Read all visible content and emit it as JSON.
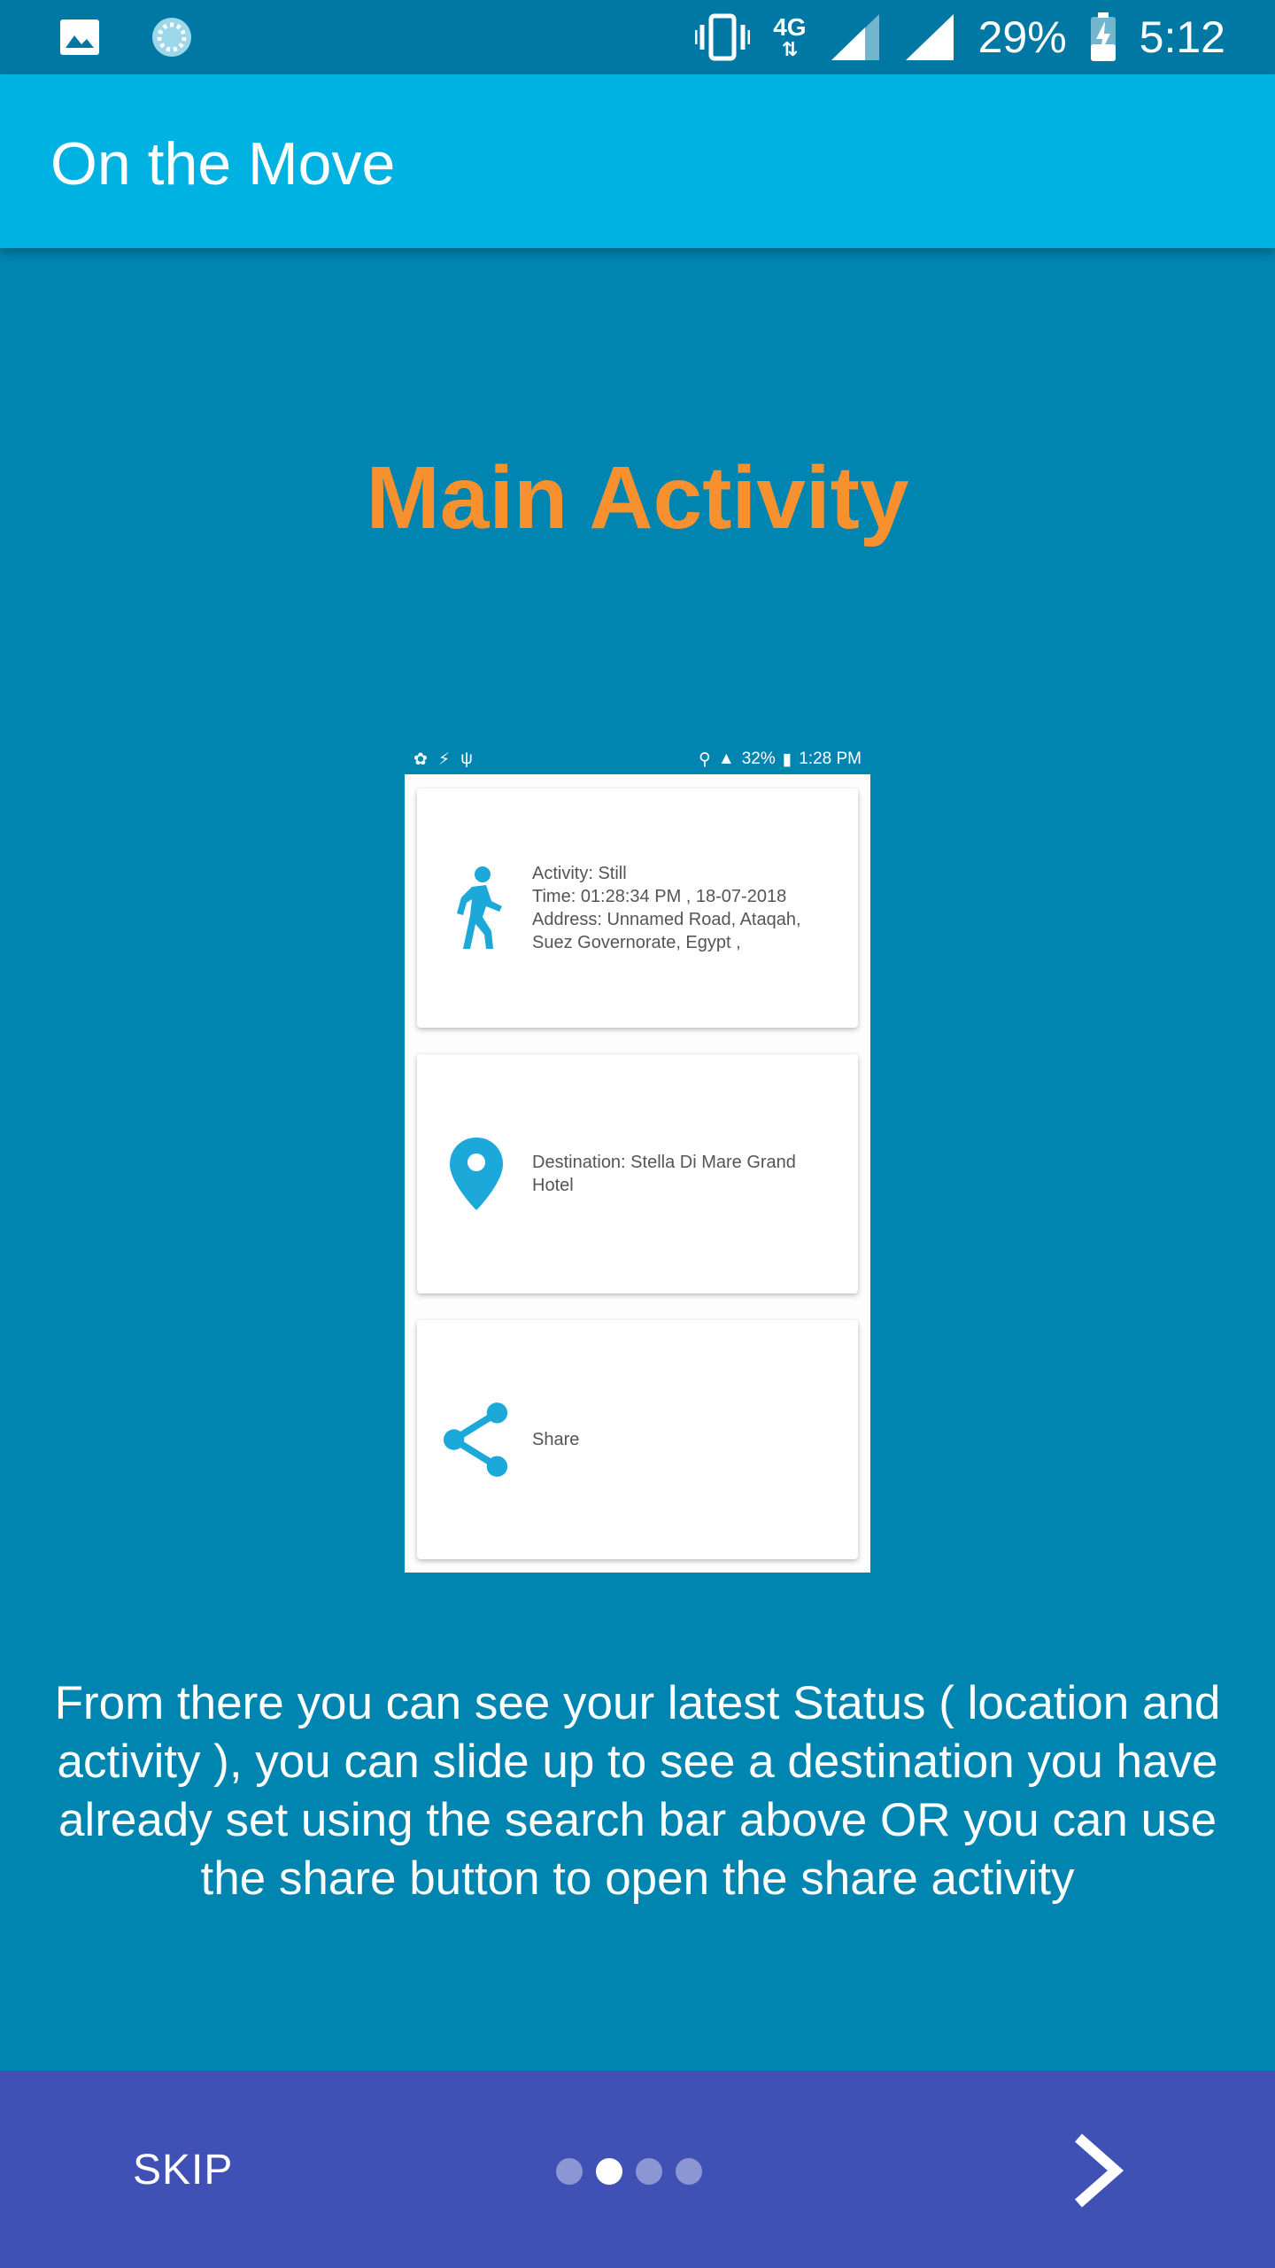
{
  "status_bar": {
    "battery": "29%",
    "time": "5:12",
    "network": "4G",
    "icons": [
      "image-icon",
      "loading-icon",
      "vibrate-icon",
      "signal-icon",
      "signal-icon",
      "battery-charging-icon"
    ]
  },
  "app_bar": {
    "title": "On the Move"
  },
  "page": {
    "heading": "Main Activity",
    "description": "From there you can see your latest Status ( location and activity ), you can slide up to see a destination you have already set using the search bar above OR you can use the share button to open the share activity"
  },
  "screenshot": {
    "status_battery": "32%",
    "status_time": "1:28 PM",
    "cards": [
      {
        "icon": "walking-person-icon",
        "lines": [
          "Activity: Still",
          "Time: 01:28:34 PM , 18-07-2018",
          "Address: Unnamed Road, Ataqah, Suez Governorate, Egypt ,"
        ]
      },
      {
        "icon": "location-pin-icon",
        "lines": [
          "Destination: Stella Di Mare Grand Hotel"
        ]
      },
      {
        "icon": "share-icon",
        "lines": [
          "Share"
        ]
      }
    ]
  },
  "bottom_bar": {
    "skip_label": "SKIP",
    "page_count": 4,
    "current_page": 2,
    "next_icon": "chevron-right-icon"
  },
  "colors": {
    "background": "#0085B0",
    "app_bar": "#00B2E2",
    "heading": "#F7902F",
    "bottom_bar": "#3F51B5",
    "icon_accent": "#1CA9DA"
  }
}
